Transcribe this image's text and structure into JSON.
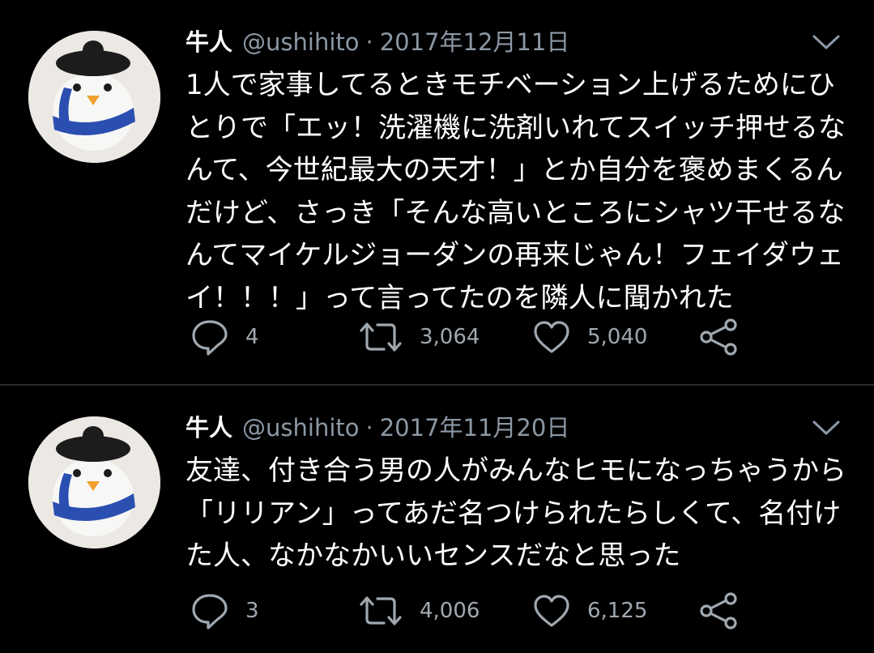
{
  "tweets": [
    {
      "name": "牛人",
      "handle": "@ushihito",
      "separator": "·",
      "date": "2017年12月11日",
      "lines": [
        "1人で家事してるときモチベーション上げるためにひ",
        "とりで「エッ！洗濯機に洗剤いれてスイッチ押せるな",
        "んて、今世紀最大の天才！」とか自分を褒めまくるん",
        "だけど、さっき「そんな高いところにシャツ干せるな",
        "んてマイケルジョーダンの再来じゃん！フェイダウェ",
        "イ！！！」って言ってたのを隣人に聞かれた"
      ],
      "reply_count": "4",
      "retweet_count": "3,064",
      "like_count": "5,040"
    },
    {
      "name": "牛人",
      "handle": "@ushihito",
      "separator": "·",
      "date": "2017年11月20日",
      "lines": [
        "友達、付き合う男の人がみんなヒモになっちゃうから",
        "「リリアン」ってあだ名つけられたらしくて、名付け",
        "た人、なかなかいいセンスだなと思った"
      ],
      "reply_count": "3",
      "retweet_count": "4,006",
      "like_count": "6,125"
    }
  ],
  "icons": {
    "reply": "speech-bubble-icon",
    "retweet": "retweet-arrows-icon",
    "like": "heart-icon",
    "share": "share-icon",
    "menu": "chevron-down-icon"
  },
  "colors": {
    "background": "#000000",
    "text": "#ffffff",
    "secondary_text": "#8b98a5",
    "icon": "#a0a8b0",
    "divider": "#2a2a2a"
  }
}
